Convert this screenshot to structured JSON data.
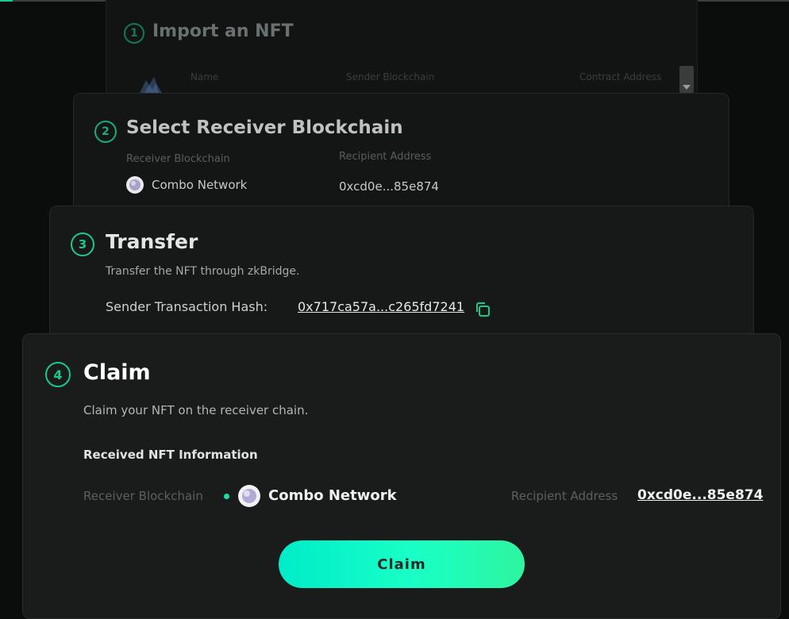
{
  "steps": {
    "import": {
      "number": "1",
      "title": "Import an NFT",
      "columns": {
        "name": "Name",
        "sender_blockchain": "Sender Blockchain",
        "contract_address": "Contract Address"
      }
    },
    "select_receiver": {
      "number": "2",
      "title": "Select Receiver Blockchain",
      "receiver_blockchain_label": "Receiver Blockchain",
      "receiver_blockchain_value": "Combo Network",
      "recipient_address_label": "Recipient Address",
      "recipient_address_value": "0xcd0e...85e874"
    },
    "transfer": {
      "number": "3",
      "title": "Transfer",
      "description": "Transfer the NFT through zkBridge.",
      "hash_label": "Sender Transaction Hash:",
      "hash_value": "0x717ca57a...c265fd7241"
    },
    "claim": {
      "number": "4",
      "title": "Claim",
      "description": "Claim your NFT on the receiver chain.",
      "received_info_heading": "Received NFT Information",
      "receiver_blockchain_label": "Receiver Blockchain",
      "receiver_blockchain_value": "Combo Network",
      "recipient_address_label": "Recipient Address",
      "recipient_address_value": "0xcd0e...85e874",
      "button_label": "Claim"
    }
  },
  "icons": {
    "chain": "combo-network-icon",
    "copy": "copy-icon",
    "nft": "nft-thumbnail"
  },
  "colors": {
    "accent": "#18c98f",
    "button_start": "#00ecc9",
    "button_end": "#2ef5a0",
    "background": "#0b0c0c"
  }
}
